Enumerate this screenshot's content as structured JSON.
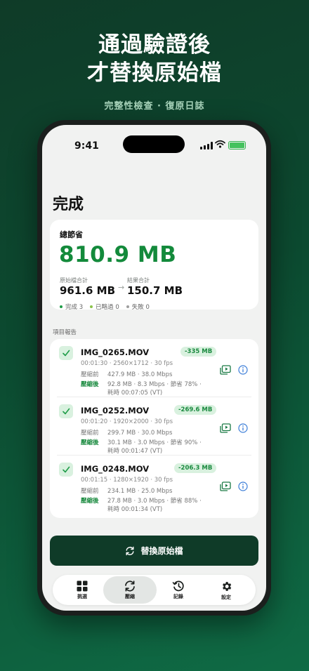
{
  "hero": {
    "line1": "通過驗證後",
    "line2": "才替換原始檔",
    "subtitle": "完整性檢查 · 復原日誌"
  },
  "status_bar": {
    "time": "9:41"
  },
  "screen": {
    "title": "完成",
    "savings": {
      "label": "總節省",
      "value": "810.9 MB",
      "original_label": "原始檔合計",
      "original_value": "961.6 MB",
      "result_label": "結果合計",
      "result_value": "150.7 MB",
      "legend": [
        {
          "text": "完成 3",
          "color": "#1f9d48"
        },
        {
          "text": "已略過 0",
          "color": "#8bc34a"
        },
        {
          "text": "失敗 0",
          "color": "#9e9e9e"
        }
      ]
    },
    "section_label": "項目報告",
    "items": [
      {
        "name": "IMG_0265.MOV",
        "delta": "-335 MB",
        "meta": "00:01:30 · 2560×1712 · 30 fps",
        "before_label": "壓縮前",
        "before": "427.9 MB · 38.0 Mbps",
        "after_label": "壓縮後",
        "after": "92.8 MB · 8.3 Mbps · 節省 78% ·",
        "duration": "耗時 00:07:05 (VT)"
      },
      {
        "name": "IMG_0252.MOV",
        "delta": "-269.6 MB",
        "meta": "00:01:20 · 1920×2000 · 30 fps",
        "before_label": "壓縮前",
        "before": "299.7 MB · 30.0 Mbps",
        "after_label": "壓縮後",
        "after": "30.1 MB · 3.0 Mbps · 節省 90% ·",
        "duration": "耗時 00:01:47 (VT)"
      },
      {
        "name": "IMG_0248.MOV",
        "delta": "-206.3 MB",
        "meta": "00:01:15 · 1280×1920 · 30 fps",
        "before_label": "壓縮前",
        "before": "234.1 MB · 25.0 Mbps",
        "after_label": "壓縮後",
        "after": "27.8 MB · 3.0 Mbps · 節省 88% ·",
        "duration": "耗時 00:01:34 (VT)"
      }
    ],
    "replace_button": "替換原始檔",
    "tabs": [
      {
        "label": "挑選",
        "icon": "grid-icon"
      },
      {
        "label": "壓縮",
        "icon": "sync-icon",
        "active": true
      },
      {
        "label": "記錄",
        "icon": "history-icon"
      },
      {
        "label": "設定",
        "icon": "gear-icon"
      }
    ]
  },
  "colors": {
    "accent": "#138a3b",
    "button": "#0f3b28",
    "pill_bg": "#d9f1df"
  }
}
